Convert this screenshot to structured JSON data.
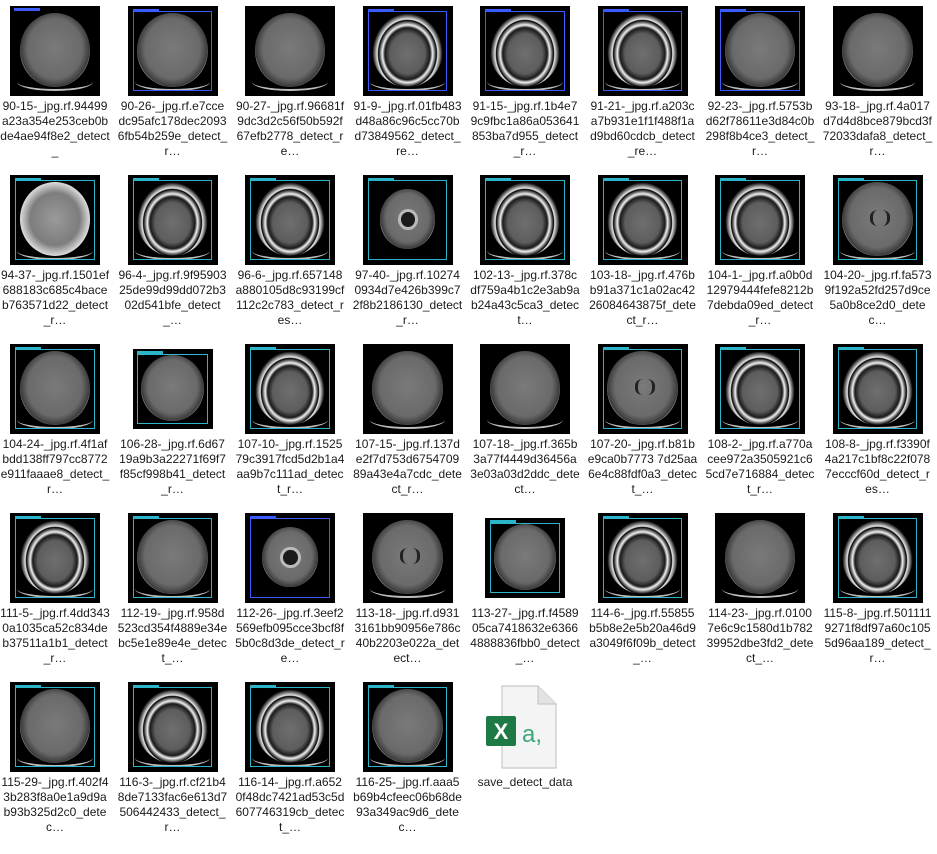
{
  "files": [
    {
      "label": "90-15-_jpg.rf.94499a23a354e253ceb0bde4ae94f8e2_detect_",
      "type": "ct"
    },
    {
      "label": "90-26-_jpg.rf.e7ccedc95afc178dec20936fb54b259e_detect_r…",
      "type": "ct"
    },
    {
      "label": "90-27-_jpg.rf.96681f9dc3d2c56f50b592f67efb2778_detect_re…",
      "type": "ct"
    },
    {
      "label": "91-9-_jpg.rf.01fb483d48a86c96c5cc70bd73849562_detect_re…",
      "type": "ct"
    },
    {
      "label": "91-15-_jpg.rf.1b4e79c9fbc1a86a053641853ba7d955_detect_r…",
      "type": "ct"
    },
    {
      "label": "91-21-_jpg.rf.a203ca7b931e1f1f488f1ad9bd60cdcb_detect_re…",
      "type": "ct"
    },
    {
      "label": "92-23-_jpg.rf.5753bd62f78611e3d84c0b298f8b4ce3_detect_r…",
      "type": "ct"
    },
    {
      "label": "93-18-_jpg.rf.4a017d7d4d8bce879bcd3f72033dafa8_detect_r…",
      "type": "ct"
    },
    {
      "label": "94-37-_jpg.rf.1501ef688183c685c4baceb763571d22_detect_r…",
      "type": "ct"
    },
    {
      "label": "96-4-_jpg.rf.9f9590325de99d99dd072b302d541bfe_detect_…",
      "type": "ct"
    },
    {
      "label": "96-6-_jpg.rf.657148a880105d8c93199cf112c2c783_detect_res…",
      "type": "ct"
    },
    {
      "label": "97-40-_jpg.rf.102740934d7e426b399c72f8b2186130_detect_r…",
      "type": "ct"
    },
    {
      "label": "102-13-_jpg.rf.378cdf759a4b1c2e3ab9ab24a43c5ca3_detect…",
      "type": "ct"
    },
    {
      "label": "103-18-_jpg.rf.476bb91a371c1a02ac4226084643875f_detect_r…",
      "type": "ct"
    },
    {
      "label": "104-1-_jpg.rf.a0b0d12979444fefe8212b7debda09ed_detect_r…",
      "type": "ct"
    },
    {
      "label": "104-20-_jpg.rf.fa5739f192a52fd257d9ce5a0b8ce2d0_detec…",
      "type": "ct"
    },
    {
      "label": "104-24-_jpg.rf.4f1afbdd138ff797cc8772e911faaae8_detect_r…",
      "type": "ct"
    },
    {
      "label": "106-28-_jpg.rf.6d6719a9b3a22271f69f7f85cf998b41_detect_r…",
      "type": "ct"
    },
    {
      "label": "107-10-_jpg.rf.152579c3917fcd5d2b1a4aa9b7c111ad_detect_r…",
      "type": "ct"
    },
    {
      "label": "107-15-_jpg.rf.137de2f7d753d675470989a43e4a7cdc_detect_r…",
      "type": "ct"
    },
    {
      "label": "107-18-_jpg.rf.365b3a77f4449d36456a3e03a03d2ddc_detect…",
      "type": "ct"
    },
    {
      "label": "107-20-_jpg.rf.b81be9ca0b7773 7d25aa6e4c88fdf0a3_detect_…",
      "type": "ct"
    },
    {
      "label": "108-2-_jpg.rf.a770acee972a3505921c65cd7e716884_detect_r…",
      "type": "ct"
    },
    {
      "label": "108-8-_jpg.rf.f3390f4a217c1bf8c22f0787ecccf60d_detect_res…",
      "type": "ct"
    },
    {
      "label": "111-5-_jpg.rf.4dd3430a1035ca52c834deb37511a1b1_detect_r…",
      "type": "ct"
    },
    {
      "label": "112-19-_jpg.rf.958d523cd354f4889e34ebc5e1e89e4e_detect_…",
      "type": "ct"
    },
    {
      "label": "112-26-_jpg.rf.3eef2569efb095cce3bcf8f5b0c8d3de_detect_re…",
      "type": "ct"
    },
    {
      "label": "113-18-_jpg.rf.d9313161bb90956e786c40b2203e022a_detect…",
      "type": "ct"
    },
    {
      "label": "113-27-_jpg.rf.f458905ca7418632e63664888836fbb0_detect_…",
      "type": "ct"
    },
    {
      "label": "114-6-_jpg.rf.55855b5b8e2e5b20a46d9a3049f6f09b_detect_…",
      "type": "ct"
    },
    {
      "label": "114-23-_jpg.rf.01007e6c9c1580d1b78239952dbe3fd2_detect_…",
      "type": "ct"
    },
    {
      "label": "115-8-_jpg.rf.5011119271f8df97a60c1055d96aa189_detect_r…",
      "type": "ct"
    },
    {
      "label": "115-29-_jpg.rf.402f43b283f8a0e1a9d9ab93b325d2c0_detec…",
      "type": "ct"
    },
    {
      "label": "116-3-_jpg.rf.cf21b48de7133fac6e613d7506442433_detect_r…",
      "type": "ct"
    },
    {
      "label": "116-14-_jpg.rf.a6520f48dc7421ad53c5d607746319cb_detect_…",
      "type": "ct"
    },
    {
      "label": "116-25-_jpg.rf.aaa5b69b4cfeec06b68de93a349ac9d6_detec…",
      "type": "ct"
    },
    {
      "label": "save_detect_data",
      "type": "excel"
    }
  ],
  "colors": {
    "box_cyan": "#2bb5c9",
    "box_blue": "#3a5cff",
    "excel_green": "#1d7a45"
  }
}
